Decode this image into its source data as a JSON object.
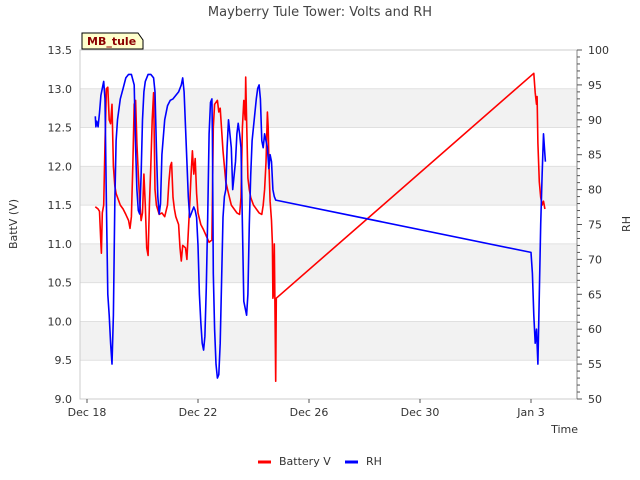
{
  "chart_data": {
    "type": "line",
    "title": "Mayberry Tule Tower: Volts and RH",
    "xlabel": "Time",
    "ylabel_left": "BattV (V)",
    "ylabel_right": "RH",
    "badge": "MB_tule",
    "x_ticks": [
      "Dec 18",
      "Dec 22",
      "Dec 26",
      "Dec 30",
      "Jan 3"
    ],
    "x_tick_days": [
      0,
      4,
      8,
      12,
      16
    ],
    "xlim_days": [
      0,
      17
    ],
    "left_ticks": [
      "9.0",
      "9.5",
      "10.0",
      "10.5",
      "11.0",
      "11.5",
      "12.0",
      "12.5",
      "13.0",
      "13.5"
    ],
    "ylim_left": [
      9.0,
      13.5
    ],
    "right_ticks": [
      "50",
      "55",
      "60",
      "65",
      "70",
      "75",
      "80",
      "85",
      "90",
      "95",
      "100"
    ],
    "ylim_right": [
      50,
      100
    ],
    "grid": true,
    "legend_position": "bottom-center",
    "series": [
      {
        "name": "Battery V",
        "axis": "left",
        "color": "#ff0000",
        "points": [
          [
            0.3,
            11.48
          ],
          [
            0.4,
            11.45
          ],
          [
            0.45,
            11.42
          ],
          [
            0.5,
            11.0
          ],
          [
            0.52,
            10.88
          ],
          [
            0.55,
            11.4
          ],
          [
            0.6,
            11.5
          ],
          [
            0.65,
            12.3
          ],
          [
            0.7,
            13.0
          ],
          [
            0.75,
            13.02
          ],
          [
            0.8,
            12.6
          ],
          [
            0.85,
            12.55
          ],
          [
            0.9,
            12.8
          ],
          [
            0.95,
            12.0
          ],
          [
            1.0,
            11.75
          ],
          [
            1.05,
            11.65
          ],
          [
            1.1,
            11.6
          ],
          [
            1.2,
            11.5
          ],
          [
            1.3,
            11.45
          ],
          [
            1.4,
            11.38
          ],
          [
            1.5,
            11.3
          ],
          [
            1.55,
            11.2
          ],
          [
            1.6,
            11.35
          ],
          [
            1.65,
            12.0
          ],
          [
            1.7,
            12.8
          ],
          [
            1.75,
            12.85
          ],
          [
            1.8,
            12.3
          ],
          [
            1.85,
            11.9
          ],
          [
            1.9,
            11.55
          ],
          [
            1.95,
            11.3
          ],
          [
            2.0,
            11.4
          ],
          [
            2.05,
            11.9
          ],
          [
            2.1,
            11.5
          ],
          [
            2.15,
            10.95
          ],
          [
            2.2,
            10.85
          ],
          [
            2.25,
            11.5
          ],
          [
            2.3,
            12.0
          ],
          [
            2.35,
            12.6
          ],
          [
            2.4,
            12.95
          ],
          [
            2.45,
            11.7
          ],
          [
            2.5,
            11.5
          ],
          [
            2.6,
            11.38
          ],
          [
            2.7,
            11.4
          ],
          [
            2.8,
            11.35
          ],
          [
            2.9,
            11.5
          ],
          [
            2.95,
            11.8
          ],
          [
            3.0,
            12.0
          ],
          [
            3.05,
            12.05
          ],
          [
            3.1,
            11.6
          ],
          [
            3.15,
            11.45
          ],
          [
            3.2,
            11.35
          ],
          [
            3.3,
            11.25
          ],
          [
            3.35,
            10.95
          ],
          [
            3.4,
            10.78
          ],
          [
            3.45,
            10.98
          ],
          [
            3.55,
            10.95
          ],
          [
            3.6,
            10.8
          ],
          [
            3.7,
            11.5
          ],
          [
            3.75,
            11.9
          ],
          [
            3.8,
            12.2
          ],
          [
            3.85,
            11.9
          ],
          [
            3.9,
            12.1
          ],
          [
            3.95,
            11.65
          ],
          [
            4.0,
            11.4
          ],
          [
            4.1,
            11.25
          ],
          [
            4.2,
            11.18
          ],
          [
            4.3,
            11.1
          ],
          [
            4.4,
            11.02
          ],
          [
            4.5,
            11.05
          ],
          [
            4.55,
            12.5
          ],
          [
            4.6,
            12.8
          ],
          [
            4.7,
            12.85
          ],
          [
            4.75,
            12.7
          ],
          [
            4.8,
            12.75
          ],
          [
            4.9,
            12.2
          ],
          [
            5.0,
            11.8
          ],
          [
            5.1,
            11.65
          ],
          [
            5.2,
            11.5
          ],
          [
            5.3,
            11.45
          ],
          [
            5.4,
            11.4
          ],
          [
            5.5,
            11.38
          ],
          [
            5.55,
            11.6
          ],
          [
            5.6,
            12.5
          ],
          [
            5.65,
            12.85
          ],
          [
            5.7,
            12.6
          ],
          [
            5.72,
            13.15
          ],
          [
            5.75,
            12.6
          ],
          [
            5.8,
            11.85
          ],
          [
            5.85,
            11.7
          ],
          [
            5.9,
            11.6
          ],
          [
            6.0,
            11.5
          ],
          [
            6.1,
            11.45
          ],
          [
            6.2,
            11.4
          ],
          [
            6.3,
            11.38
          ],
          [
            6.35,
            11.5
          ],
          [
            6.4,
            11.7
          ],
          [
            6.45,
            12.05
          ],
          [
            6.5,
            12.7
          ],
          [
            6.53,
            12.5
          ],
          [
            6.56,
            12.0
          ],
          [
            6.6,
            11.55
          ],
          [
            6.65,
            11.3
          ],
          [
            6.68,
            11.0
          ],
          [
            6.7,
            10.3
          ],
          [
            6.72,
            10.35
          ],
          [
            6.75,
            11.0
          ],
          [
            6.78,
            10.0
          ],
          [
            6.8,
            9.23
          ],
          [
            6.82,
            10.3
          ],
          [
            16.1,
            13.2
          ],
          [
            16.15,
            12.95
          ],
          [
            16.2,
            12.8
          ],
          [
            16.22,
            12.9
          ],
          [
            16.25,
            12.3
          ],
          [
            16.3,
            11.8
          ],
          [
            16.35,
            11.6
          ],
          [
            16.4,
            11.5
          ],
          [
            16.45,
            11.55
          ],
          [
            16.5,
            11.45
          ]
        ]
      },
      {
        "name": "RH",
        "axis": "right",
        "color": "#0000ff",
        "points": [
          [
            0.3,
            90.5
          ],
          [
            0.32,
            89.0
          ],
          [
            0.35,
            89.8
          ],
          [
            0.4,
            89.0
          ],
          [
            0.45,
            91.0
          ],
          [
            0.5,
            93.5
          ],
          [
            0.55,
            94.5
          ],
          [
            0.6,
            95.5
          ],
          [
            0.65,
            93.0
          ],
          [
            0.7,
            78.0
          ],
          [
            0.75,
            65.0
          ],
          [
            0.8,
            62.0
          ],
          [
            0.85,
            58.0
          ],
          [
            0.9,
            55.0
          ],
          [
            0.95,
            62.0
          ],
          [
            1.0,
            78.0
          ],
          [
            1.05,
            87.0
          ],
          [
            1.1,
            90.0
          ],
          [
            1.2,
            93.0
          ],
          [
            1.3,
            94.5
          ],
          [
            1.4,
            96.0
          ],
          [
            1.5,
            96.5
          ],
          [
            1.6,
            96.5
          ],
          [
            1.7,
            95.0
          ],
          [
            1.75,
            86.0
          ],
          [
            1.8,
            80.0
          ],
          [
            1.85,
            77.0
          ],
          [
            1.9,
            76.5
          ],
          [
            1.95,
            82.0
          ],
          [
            2.0,
            90.0
          ],
          [
            2.05,
            94.0
          ],
          [
            2.1,
            95.5
          ],
          [
            2.2,
            96.5
          ],
          [
            2.3,
            96.5
          ],
          [
            2.4,
            96.0
          ],
          [
            2.45,
            94.0
          ],
          [
            2.5,
            86.0
          ],
          [
            2.55,
            79.0
          ],
          [
            2.6,
            76.5
          ],
          [
            2.65,
            78.0
          ],
          [
            2.7,
            85.0
          ],
          [
            2.8,
            90.0
          ],
          [
            2.9,
            92.0
          ],
          [
            3.0,
            92.8
          ],
          [
            3.1,
            93.0
          ],
          [
            3.2,
            93.5
          ],
          [
            3.3,
            94.0
          ],
          [
            3.4,
            95.0
          ],
          [
            3.45,
            96.0
          ],
          [
            3.5,
            94.0
          ],
          [
            3.55,
            89.0
          ],
          [
            3.6,
            84.0
          ],
          [
            3.65,
            79.0
          ],
          [
            3.7,
            76.0
          ],
          [
            3.75,
            76.5
          ],
          [
            3.8,
            77.0
          ],
          [
            3.85,
            77.5
          ],
          [
            3.9,
            77.0
          ],
          [
            3.95,
            76.0
          ],
          [
            4.0,
            72.0
          ],
          [
            4.05,
            65.0
          ],
          [
            4.1,
            61.0
          ],
          [
            4.15,
            58.0
          ],
          [
            4.2,
            57.0
          ],
          [
            4.25,
            59.0
          ],
          [
            4.3,
            66.0
          ],
          [
            4.35,
            76.0
          ],
          [
            4.4,
            88.0
          ],
          [
            4.45,
            92.5
          ],
          [
            4.5,
            93.0
          ],
          [
            4.52,
            88.0
          ],
          [
            4.55,
            68.0
          ],
          [
            4.6,
            60.0
          ],
          [
            4.65,
            55.0
          ],
          [
            4.7,
            53.0
          ],
          [
            4.75,
            53.5
          ],
          [
            4.8,
            58.0
          ],
          [
            4.85,
            67.0
          ],
          [
            4.9,
            76.0
          ],
          [
            4.95,
            79.0
          ],
          [
            5.0,
            80.0
          ],
          [
            5.05,
            86.0
          ],
          [
            5.1,
            90.0
          ],
          [
            5.15,
            88.0
          ],
          [
            5.2,
            86.0
          ],
          [
            5.25,
            80.0
          ],
          [
            5.3,
            82.0
          ],
          [
            5.35,
            84.0
          ],
          [
            5.4,
            88.0
          ],
          [
            5.45,
            89.5
          ],
          [
            5.5,
            88.0
          ],
          [
            5.55,
            86.0
          ],
          [
            5.6,
            75.0
          ],
          [
            5.65,
            64.0
          ],
          [
            5.7,
            63.0
          ],
          [
            5.75,
            62.0
          ],
          [
            5.8,
            65.0
          ],
          [
            5.85,
            75.0
          ],
          [
            5.9,
            82.0
          ],
          [
            5.95,
            87.0
          ],
          [
            6.0,
            89.0
          ],
          [
            6.05,
            91.0
          ],
          [
            6.1,
            93.0
          ],
          [
            6.15,
            94.5
          ],
          [
            6.2,
            95.0
          ],
          [
            6.25,
            93.0
          ],
          [
            6.3,
            87.0
          ],
          [
            6.35,
            86.0
          ],
          [
            6.4,
            88.0
          ],
          [
            6.45,
            87.0
          ],
          [
            6.5,
            86.0
          ],
          [
            6.55,
            83.0
          ],
          [
            6.6,
            85.0
          ],
          [
            6.65,
            84.0
          ],
          [
            6.7,
            80.0
          ],
          [
            6.75,
            79.0
          ],
          [
            6.8,
            78.5
          ],
          [
            16.0,
            71.0
          ],
          [
            16.05,
            68.0
          ],
          [
            16.1,
            62.0
          ],
          [
            16.15,
            58.0
          ],
          [
            16.2,
            60.0
          ],
          [
            16.25,
            55.0
          ],
          [
            16.3,
            65.0
          ],
          [
            16.35,
            75.0
          ],
          [
            16.4,
            82.0
          ],
          [
            16.45,
            88.0
          ],
          [
            16.5,
            85.0
          ],
          [
            16.52,
            84.0
          ]
        ]
      }
    ]
  }
}
